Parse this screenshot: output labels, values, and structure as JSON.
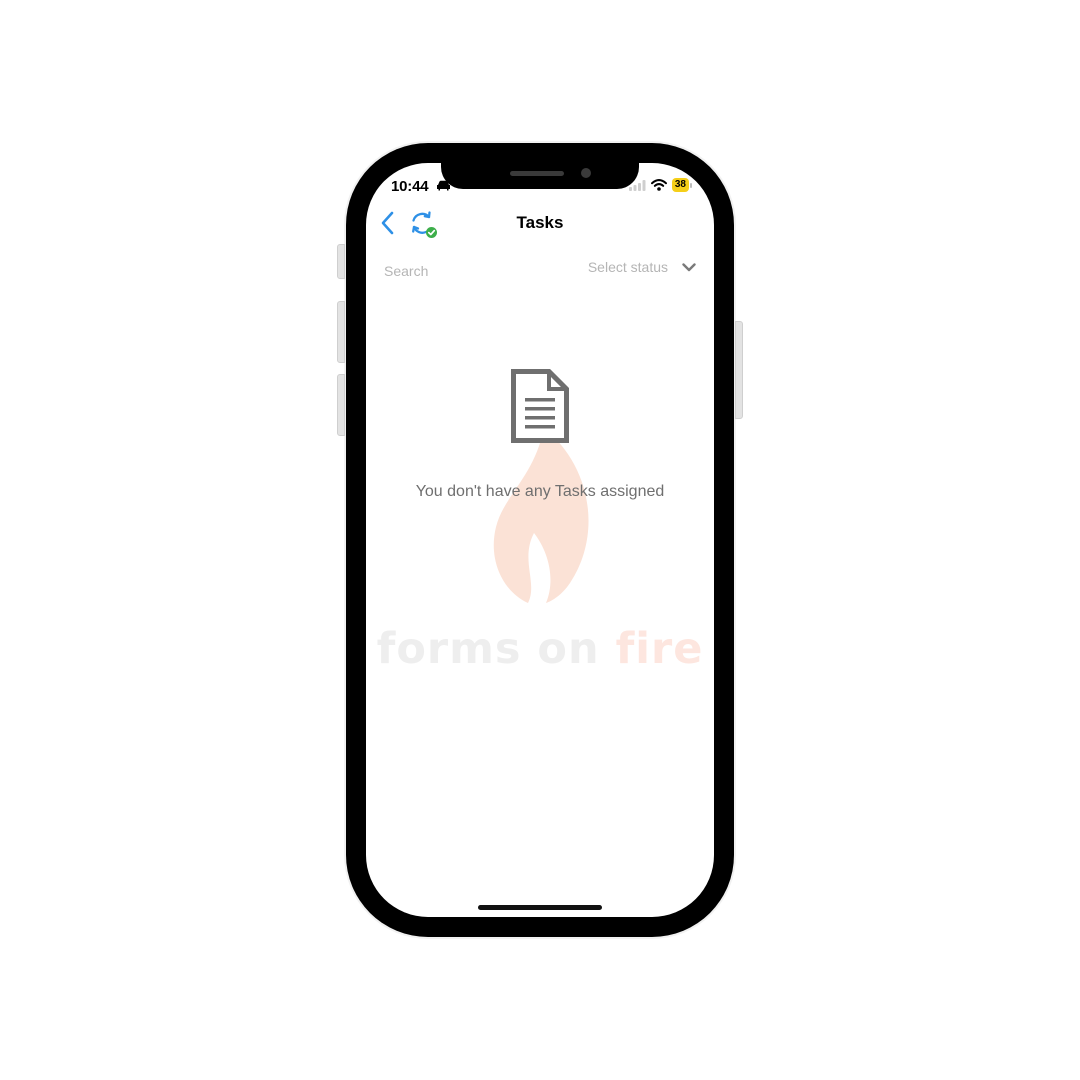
{
  "status_bar": {
    "time": "10:44",
    "battery_level": "38",
    "icons": [
      "car-icon",
      "signal-icon",
      "wifi-icon",
      "battery-icon"
    ]
  },
  "header": {
    "title": "Tasks",
    "back_icon": "chevron-left-icon",
    "sync_icon": "sync-check-icon"
  },
  "filters": {
    "search_placeholder": "Search",
    "status_placeholder": "Select status",
    "status_icon": "chevron-down-icon"
  },
  "empty_state": {
    "icon": "document-icon",
    "message": "You don't have any Tasks assigned"
  },
  "watermark": {
    "brand_primary": "forms on ",
    "brand_accent": "fire"
  },
  "colors": {
    "accent": "#2e90e6",
    "sync_badge": "#3cae4a",
    "battery": "#f5cf19",
    "empty_icon": "#6f6f6f",
    "watermark_gray": "#eeeeee",
    "watermark_flame": "#fbe2d6"
  }
}
